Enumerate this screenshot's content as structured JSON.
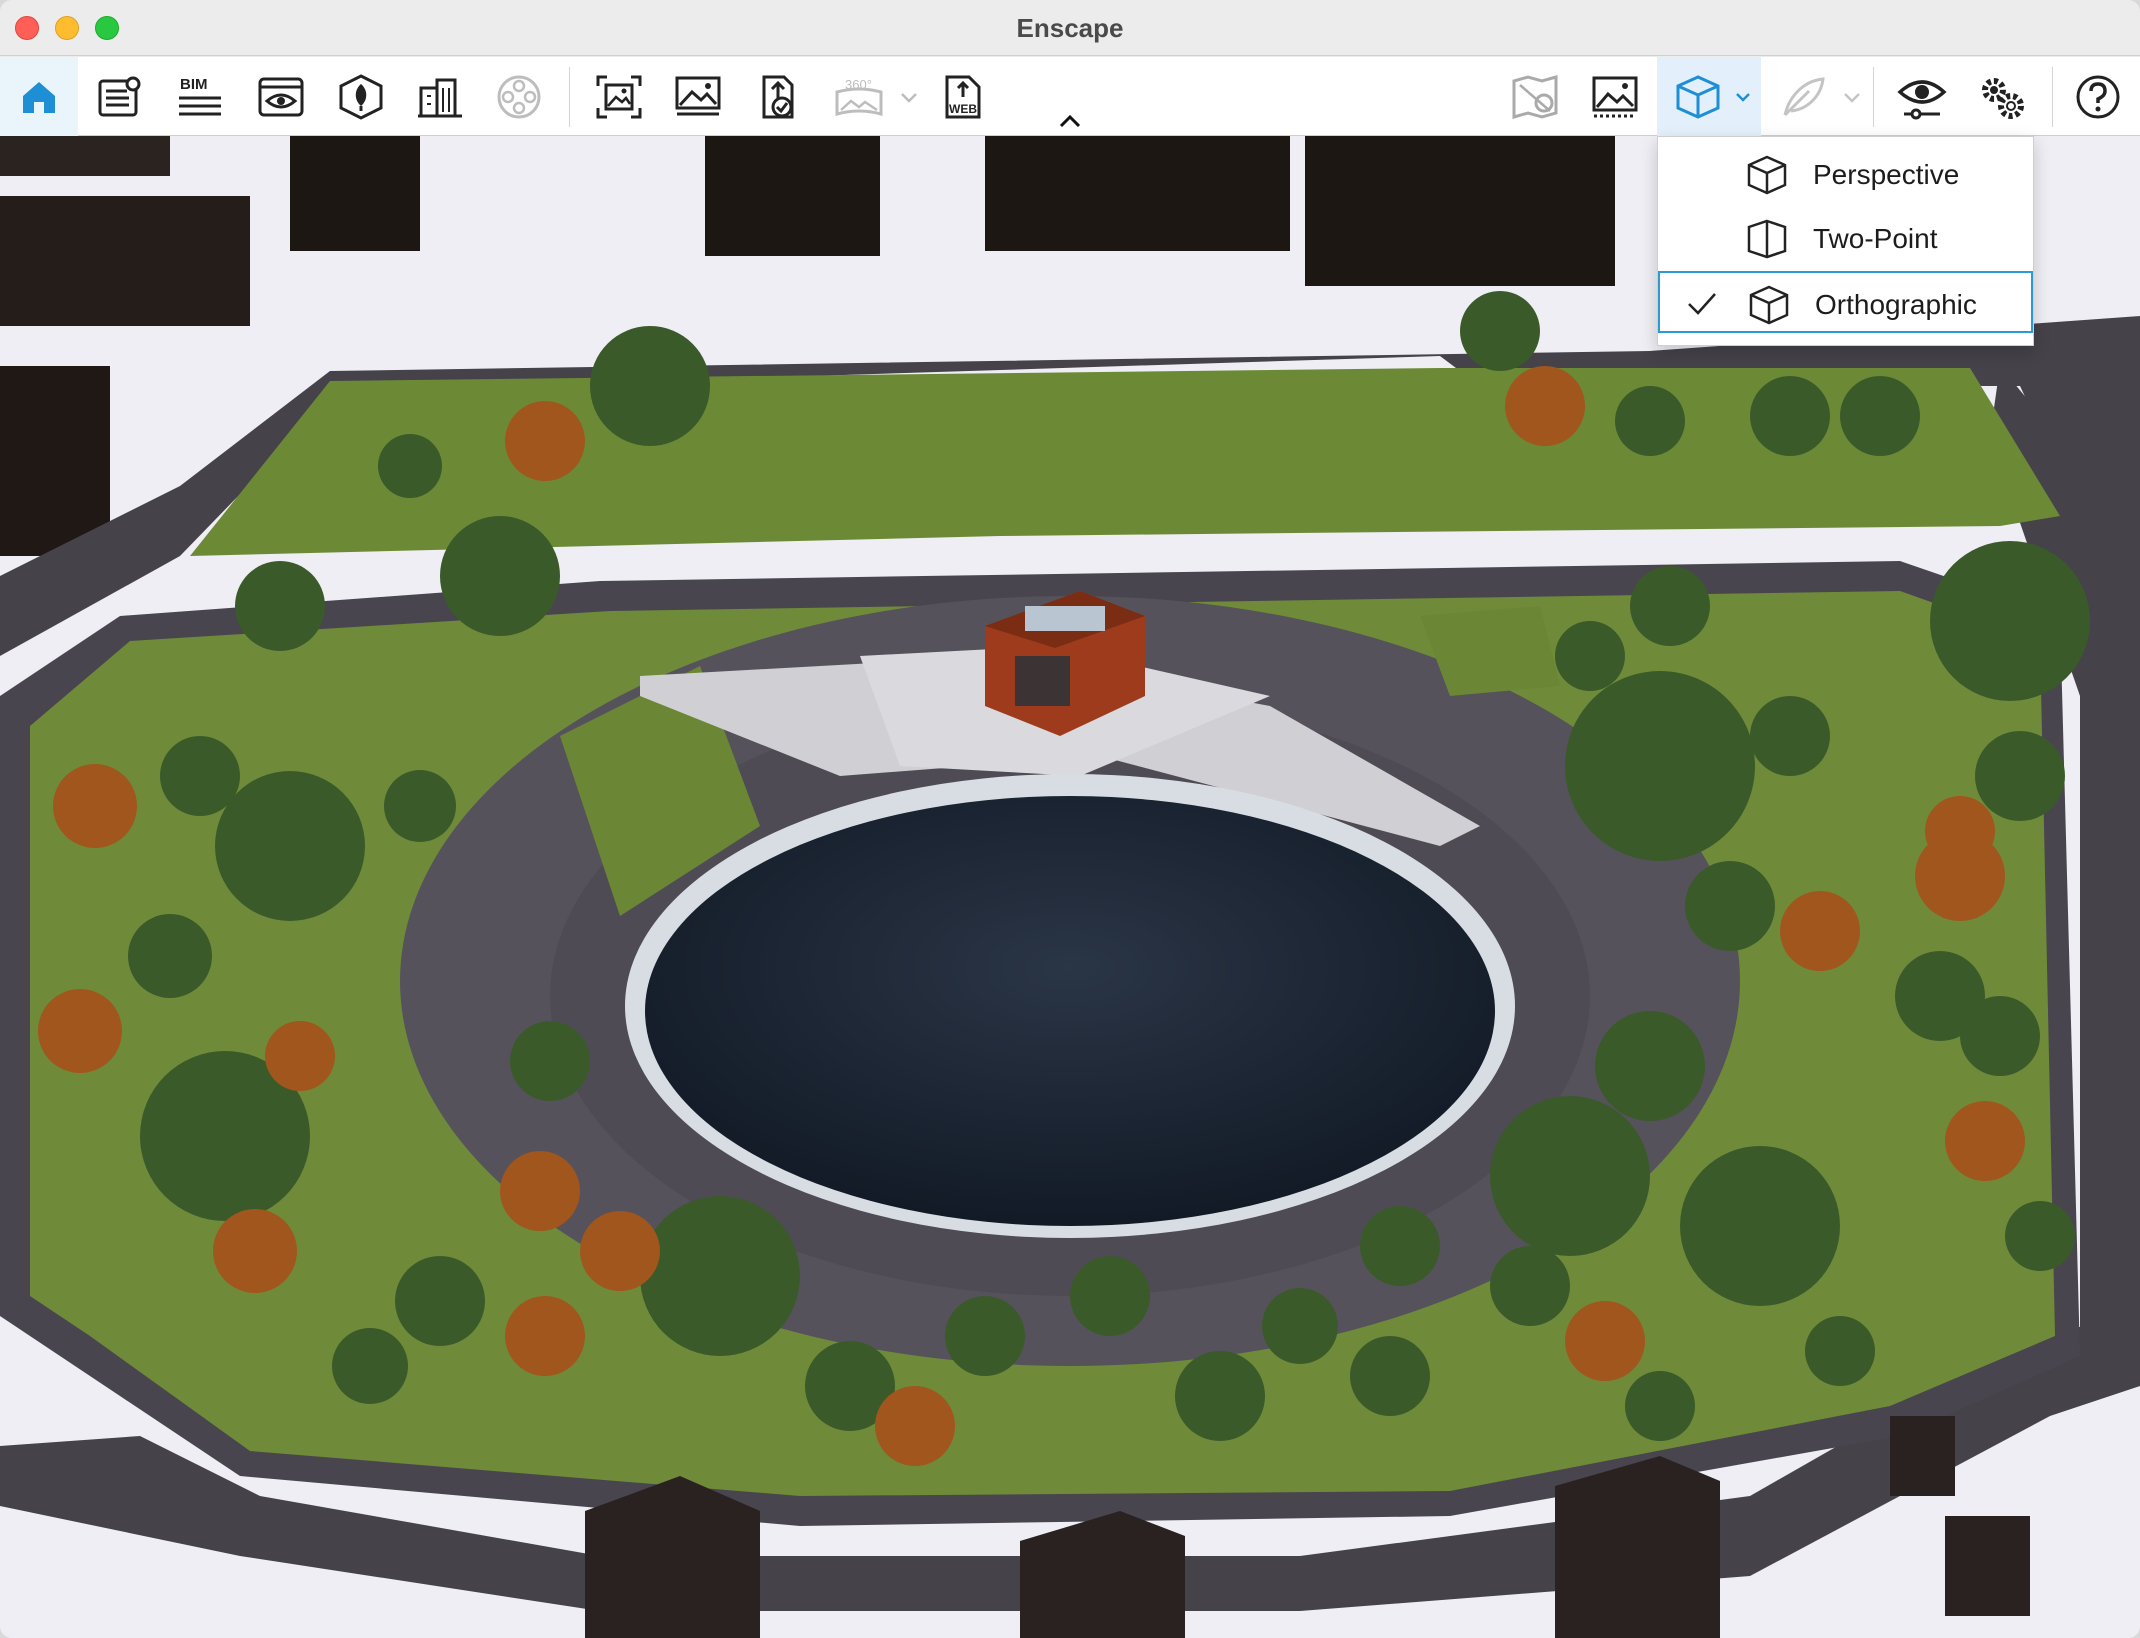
{
  "window": {
    "title": "Enscape"
  },
  "toolbar": {
    "left_icons": [
      "home-icon",
      "notes-icon",
      "bim-icon",
      "preview-window-icon",
      "assets-icon",
      "site-context-icon",
      "video-editor-icon"
    ],
    "bim_label": "BIM",
    "capture_icons": [
      "batch-render-icon",
      "screenshot-icon",
      "upload-icon",
      "panorama-icon",
      "web-standalone-icon"
    ],
    "panorama_label": "360°",
    "web_label": "WEB",
    "right_icons": [
      "map-icon",
      "visual-settings-icon",
      "projection-icon",
      "feather-icon",
      "view-icon",
      "settings-icon",
      "help-icon"
    ]
  },
  "projection_menu": {
    "items": [
      {
        "label": "Perspective",
        "checked": false
      },
      {
        "label": "Two-Point",
        "checked": false
      },
      {
        "label": "Orthographic",
        "checked": true
      }
    ]
  },
  "viewport": {
    "description_icon": "architectural-render-view",
    "colors": {
      "grass": "#6f8b3a",
      "road": "#4d4952",
      "water": "#1b2533",
      "pavilion": "#9e3b1c",
      "snow": "#f2f2f6"
    }
  }
}
